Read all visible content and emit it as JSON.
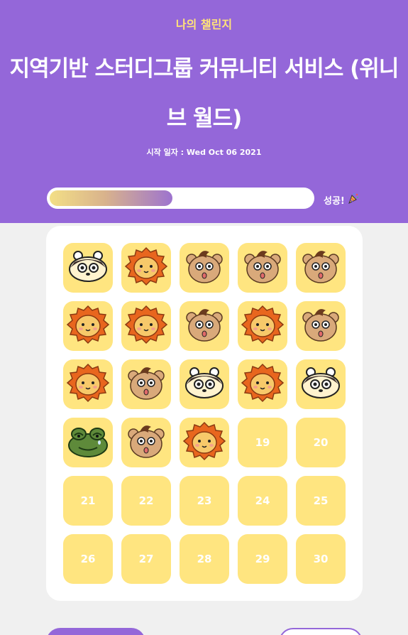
{
  "header": {
    "subtitle": "나의 챌린지",
    "title": "지역기반 스터디그룹 커뮤니티 서비스 (위니브 월드)",
    "start_date": "시작 일자 : Wed Oct 06 2021"
  },
  "progress": {
    "completed": 18,
    "total": 30,
    "fraction": 0.6,
    "label": "성공!",
    "icon": "party-popper-icon"
  },
  "colors": {
    "header_bg": "#9467d9",
    "cell_bg": "#ffe580",
    "subtitle": "#ffe27a"
  },
  "stamps": [
    "hamster",
    "lion",
    "bear",
    "bear",
    "bear",
    "lion",
    "lion",
    "bear",
    "lion",
    "bear",
    "lion",
    "bear",
    "hamster",
    "lion",
    "hamster",
    "frog",
    "bear",
    "lion"
  ],
  "cells": [
    {
      "label": "19"
    },
    {
      "label": "20"
    },
    {
      "label": "21"
    },
    {
      "label": "22"
    },
    {
      "label": "23"
    },
    {
      "label": "24"
    },
    {
      "label": "25"
    },
    {
      "label": "26"
    },
    {
      "label": "27"
    },
    {
      "label": "28"
    },
    {
      "label": "29"
    },
    {
      "label": "30"
    }
  ]
}
